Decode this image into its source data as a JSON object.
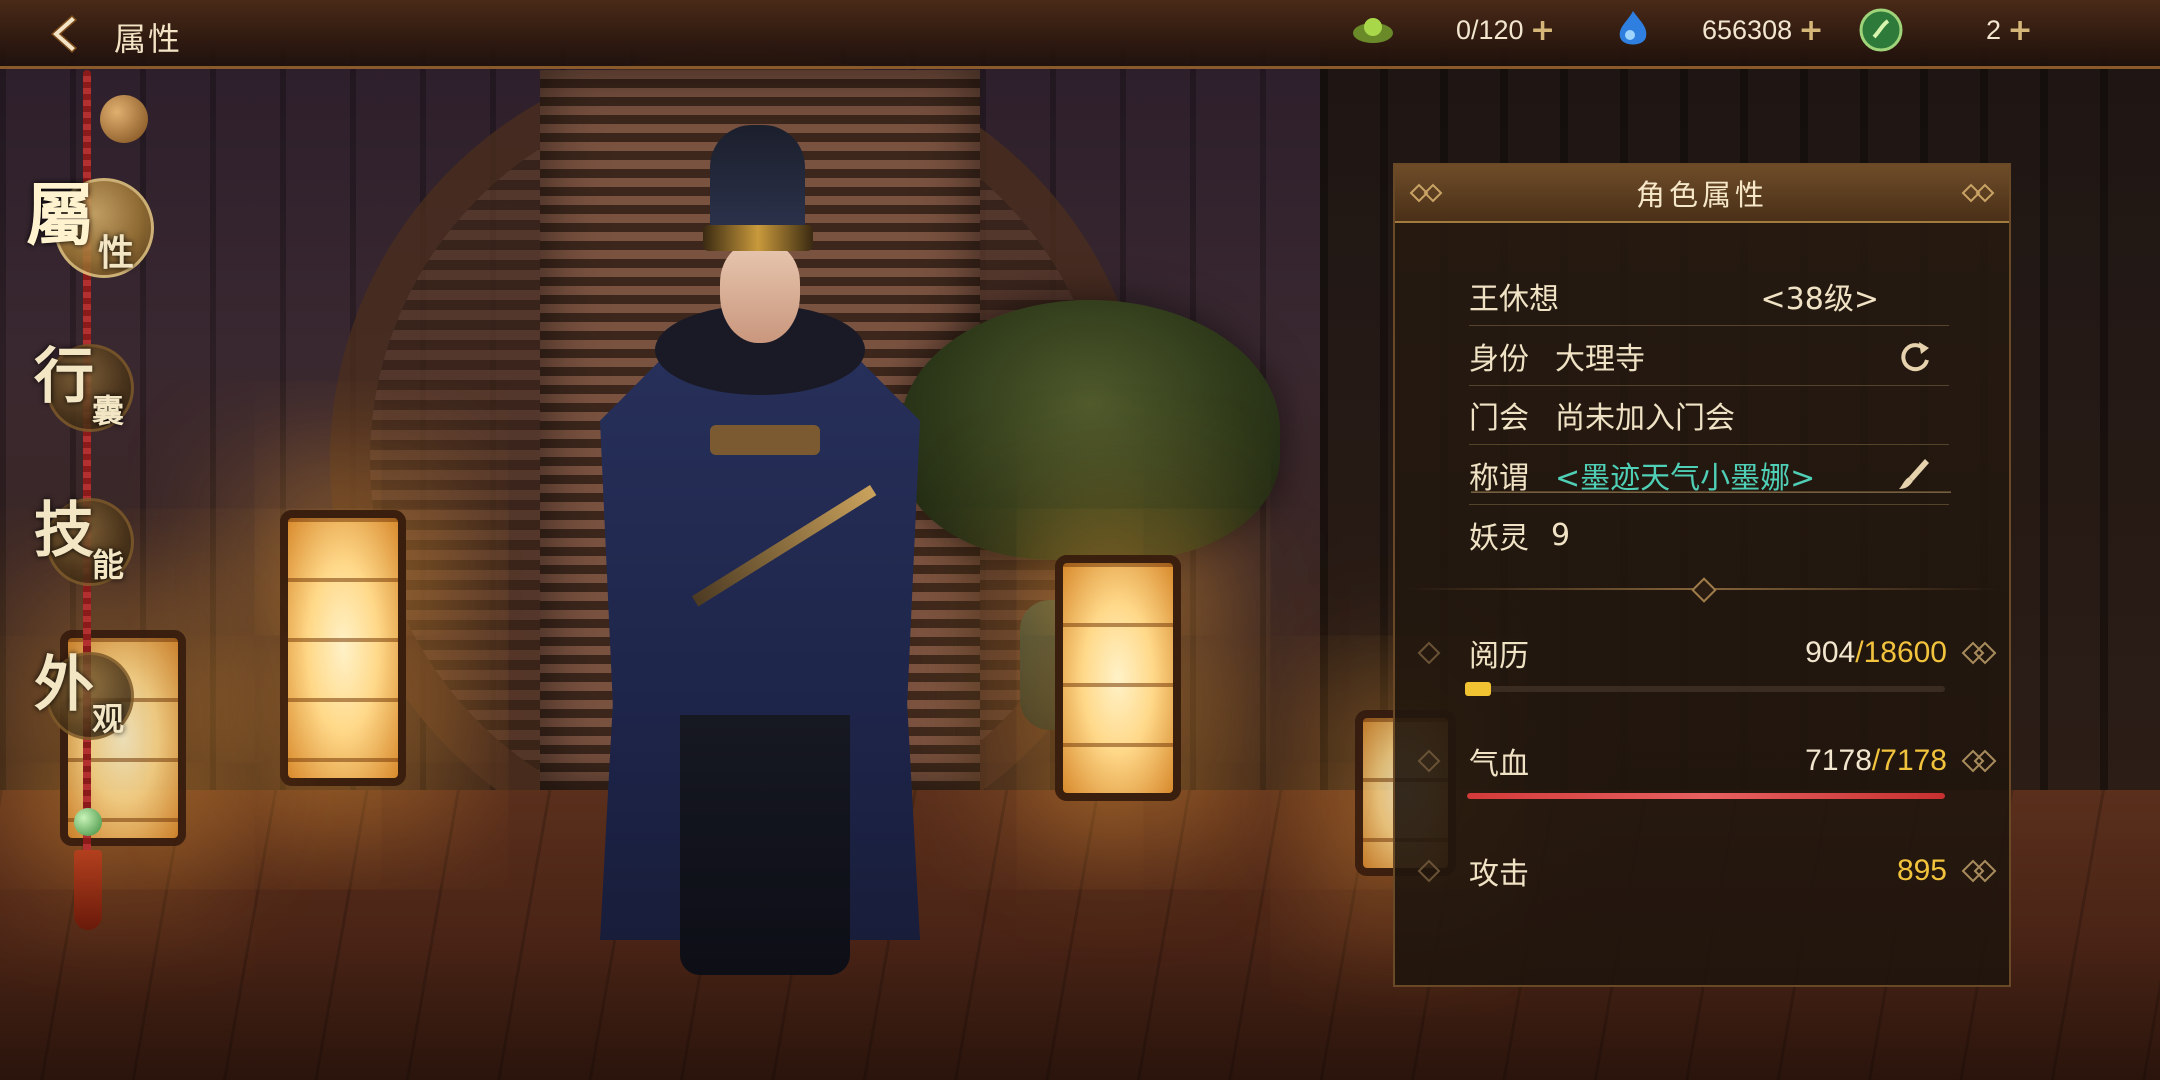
{
  "header": {
    "title": "属性",
    "resources": [
      {
        "icon": "jade-icon",
        "value": "0/120"
      },
      {
        "icon": "blue-spirit-icon",
        "value": "656308"
      },
      {
        "icon": "green-coin-icon",
        "value": "2"
      }
    ]
  },
  "nav": {
    "items": [
      {
        "big": "屬",
        "small": "性",
        "active": true
      },
      {
        "big": "行",
        "small": "囊",
        "active": false
      },
      {
        "big": "技",
        "small": "能",
        "active": false
      },
      {
        "big": "外",
        "small": "观",
        "active": false
      }
    ]
  },
  "panel": {
    "title": "角色属性",
    "name": "王休想",
    "level": "<38级>",
    "identity_label": "身份",
    "identity_value": "大理寺",
    "guild_label": "门会",
    "guild_value": "尚未加入门会",
    "title_label": "称谓",
    "title_value": "<墨迹天气小墨娜>",
    "spirit_label": "妖灵",
    "spirit_value": "9",
    "stats": [
      {
        "label": "阅历",
        "current": "904",
        "max": "/18600",
        "progress": 0.049
      },
      {
        "label": "气血",
        "current": "7178",
        "max": "/7178",
        "progress": 1.0
      },
      {
        "label": "攻击",
        "value": "895"
      }
    ]
  },
  "colors": {
    "accent_gold": "#f2c33c",
    "teal_text": "#4fcfb6",
    "hp_bar": "#d53a3a",
    "exp_bar": "#f1c232"
  }
}
